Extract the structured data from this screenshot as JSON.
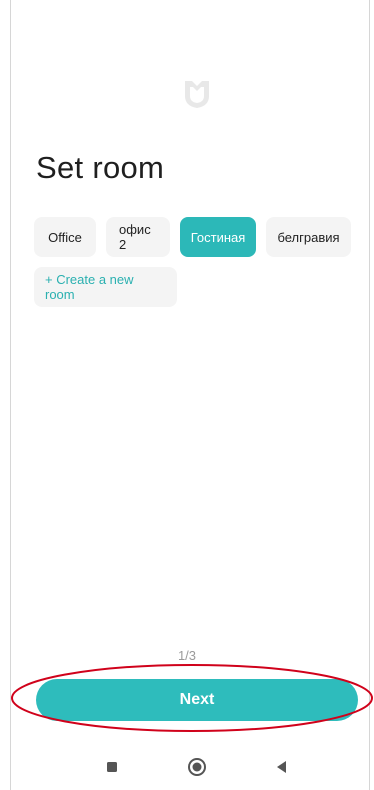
{
  "screen": {
    "title": "Set room"
  },
  "rooms": [
    {
      "label": "Office",
      "selected": false
    },
    {
      "label": "офис 2",
      "selected": false
    },
    {
      "label": "Гостиная",
      "selected": true
    },
    {
      "label": "белгравия",
      "selected": false
    }
  ],
  "create_room_label": "+ Create a new room",
  "pager": "1/3",
  "next_label": "Next",
  "colors": {
    "accent": "#2ebcbc",
    "chip_bg": "#f4f4f4",
    "annotation": "#d0021b"
  },
  "icons": {
    "logo": "mi-home-logo-icon",
    "nav_recents": "square-recents-icon",
    "nav_home": "circle-home-icon",
    "nav_back": "triangle-back-icon"
  }
}
